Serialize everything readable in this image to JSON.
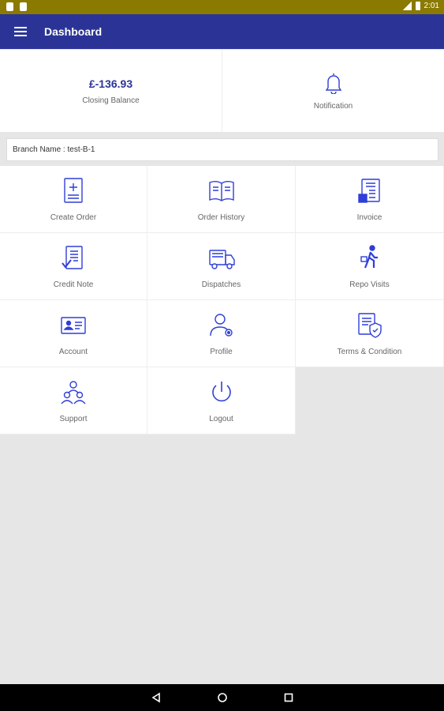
{
  "status_bar": {
    "time": "2:01"
  },
  "app_bar": {
    "title": "Dashboard",
    "menu_icon": "menu-icon"
  },
  "summary": {
    "closing_balance_value": "£-136.93",
    "closing_balance_label": "Closing Balance",
    "notification_label": "Notification"
  },
  "branch": {
    "text": "Branch Name : test-B-1"
  },
  "tiles": [
    {
      "label": "Create Order",
      "icon": "create-order-icon"
    },
    {
      "label": "Order History",
      "icon": "book-icon"
    },
    {
      "label": "Invoice",
      "icon": "invoice-icon"
    },
    {
      "label": "Credit Note",
      "icon": "credit-note-icon"
    },
    {
      "label": "Dispatches",
      "icon": "truck-icon"
    },
    {
      "label": "Repo Visits",
      "icon": "walking-person-icon"
    },
    {
      "label": "Account",
      "icon": "id-card-icon"
    },
    {
      "label": "Profile",
      "icon": "user-settings-icon"
    },
    {
      "label": "Terms & Condition",
      "icon": "document-shield-icon"
    },
    {
      "label": "Support",
      "icon": "support-team-icon"
    },
    {
      "label": "Logout",
      "icon": "power-icon"
    }
  ],
  "colors": {
    "primary": "#2b3496",
    "status_bar": "#8a7a00",
    "icon_blue": "#2f3ed8"
  }
}
